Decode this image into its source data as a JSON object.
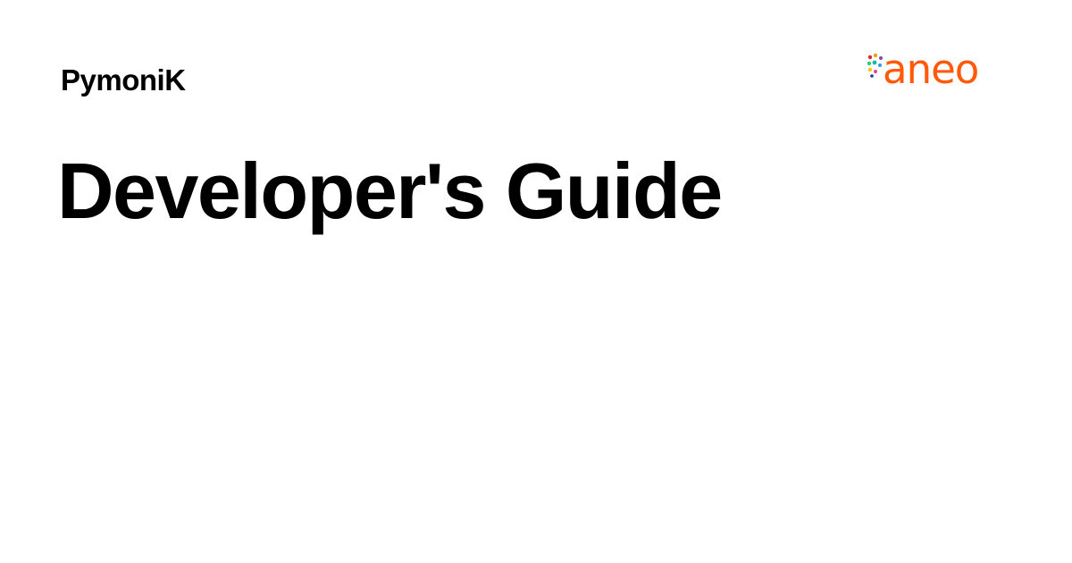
{
  "site": {
    "name": "PymoniK"
  },
  "page": {
    "title": "Developer's Guide"
  },
  "logo": {
    "text": "aneo",
    "color": "#ff5a0a",
    "dot_colors": [
      "#e8222d",
      "#f39c12",
      "#8e44ad",
      "#2ecc71",
      "#1abc9c",
      "#3498db",
      "#f1c40f",
      "#e84393",
      "#1e3799"
    ]
  },
  "colors": {
    "background": "#ffffff",
    "text": "#000000"
  }
}
